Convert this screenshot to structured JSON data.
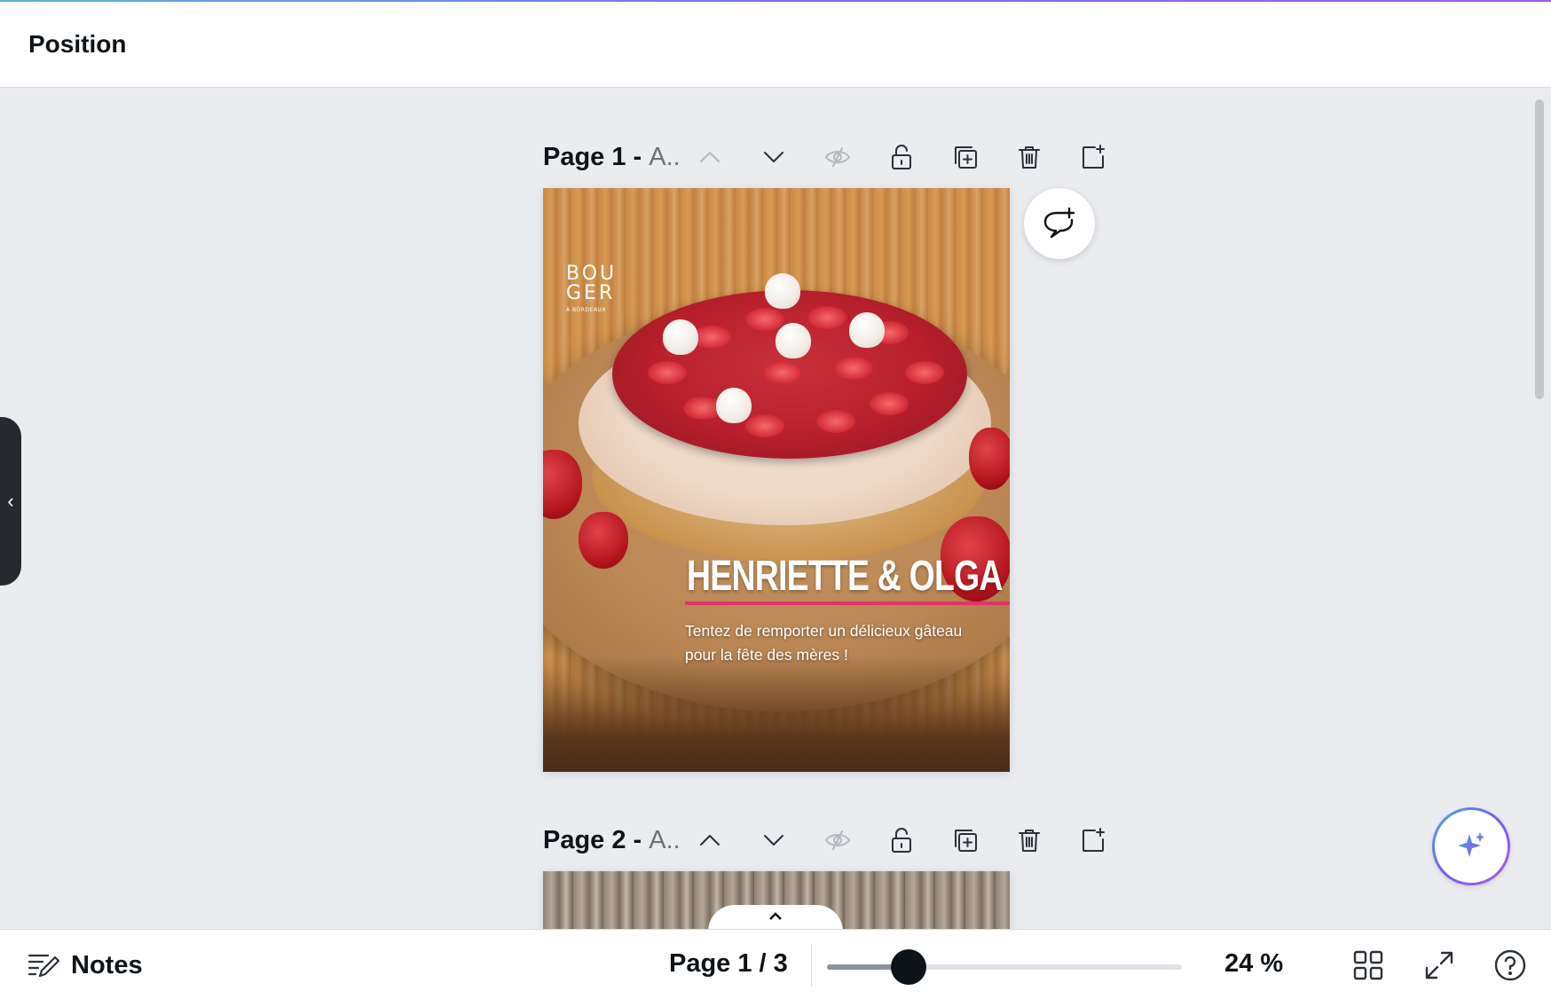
{
  "topbar": {
    "title": "Position"
  },
  "pages": [
    {
      "label": "Page 1 -",
      "title": "A..",
      "actions": [
        "move-up",
        "move-down",
        "hide",
        "lock",
        "duplicate",
        "delete",
        "add-page"
      ],
      "design": {
        "logo_line1": "BOU",
        "logo_line2": "GER",
        "logo_sub": "À BORDEAUX",
        "headline": "HENRIETTE & OLGA",
        "body": "Tentez de remporter un délicieux gâteau pour la fête des mères !",
        "accent_color": "#e0336a"
      }
    },
    {
      "label": "Page 2 -",
      "title": "A..",
      "actions": [
        "move-up",
        "move-down",
        "hide",
        "lock",
        "duplicate",
        "delete",
        "add-page"
      ]
    }
  ],
  "bottombar": {
    "notes_label": "Notes",
    "page_indicator": "Page 1 / 3",
    "zoom_label": "24 %",
    "zoom_fraction": 0.23
  },
  "icons": {
    "side_toggle": "chevron-left-icon",
    "comment": "add-comment-icon",
    "magic": "sparkle-icon",
    "grid": "grid-view-icon",
    "fullscreen": "expand-icon",
    "help": "help-icon"
  }
}
